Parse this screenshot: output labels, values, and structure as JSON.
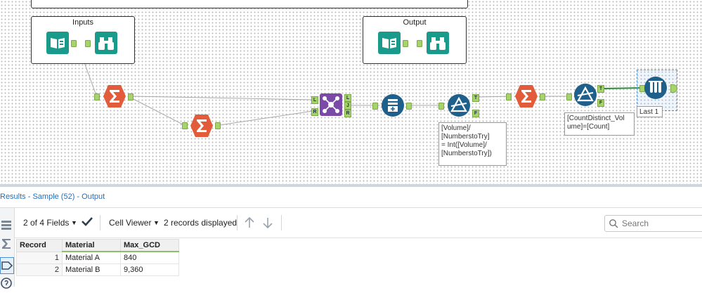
{
  "canvas": {
    "containers": [
      {
        "title": "Inputs"
      },
      {
        "title": "Output"
      }
    ],
    "anchor_labels": {
      "join": [
        "L",
        "J",
        "R"
      ],
      "filter": [
        "T",
        "F"
      ]
    },
    "annotations": {
      "filter1": "[Volume]/\n[NumberstoTry]\n= Int([Volume]/\n[NumberstoTry])",
      "filter2": "[CountDistinct_Vol\nume]=[Count]",
      "sample": "Last 1"
    },
    "colors": {
      "summarize": "#e25c3b",
      "join": "#7b4aa8",
      "filter": "#1f5f8b",
      "input": "#1a9a8b",
      "browse": "#1a9a8b",
      "anchor": "#a7d36b",
      "selected": "#4a90d9"
    }
  },
  "results": {
    "title": "Results - Sample (52) - Output",
    "toolbar": {
      "fields_label": "2 of 4 Fields",
      "cell_viewer_label": "Cell Viewer",
      "records_label": "2 records displayed",
      "search_placeholder": "Search"
    },
    "table": {
      "headers": [
        "Record",
        "Material",
        "Max_GCD"
      ],
      "rows": [
        {
          "record": "1",
          "material": "Material A",
          "max_gcd": "840"
        },
        {
          "record": "2",
          "material": "Material B",
          "max_gcd": "9,360"
        }
      ]
    }
  }
}
